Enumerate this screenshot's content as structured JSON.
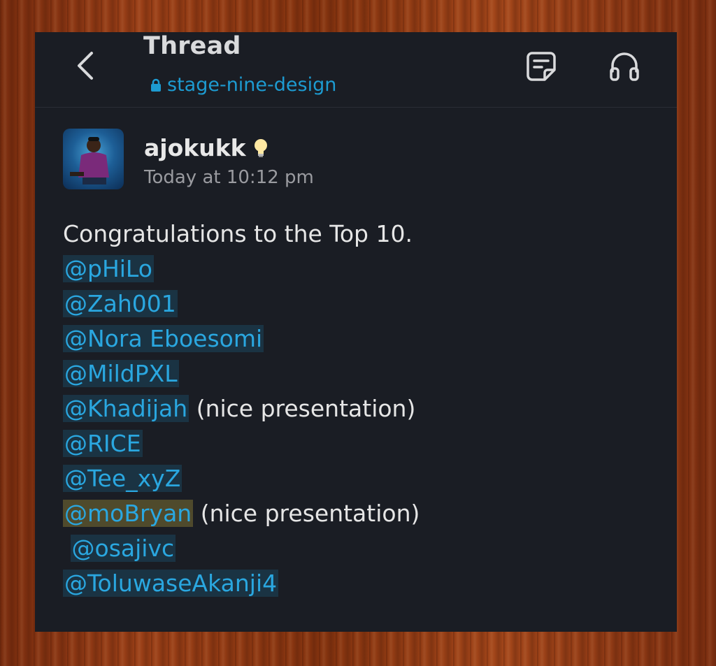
{
  "header": {
    "title": "Thread",
    "channel": "stage-nine-design",
    "back_icon": "chevron-left-icon",
    "notes_icon": "notes-icon",
    "huddle_icon": "headphones-icon"
  },
  "message": {
    "username": "ajokukk",
    "status_emoji": "light-bulb",
    "timestamp": "Today at 10:12 pm",
    "intro": "Congratulations to the Top 10.",
    "mentions": [
      {
        "handle": "@pHiLo",
        "note": ""
      },
      {
        "handle": "@Zah001",
        "note": ""
      },
      {
        "handle": "@Nora Eboesomi",
        "note": ""
      },
      {
        "handle": "@MildPXL",
        "note": ""
      },
      {
        "handle": "@Khadijah",
        "note": " (nice presentation)"
      },
      {
        "handle": "@RICE",
        "note": ""
      },
      {
        "handle": "@Tee_xyZ",
        "note": ""
      },
      {
        "handle": "@moBryan",
        "note": " (nice presentation)"
      },
      {
        "handle": "@osajivc",
        "note": ""
      },
      {
        "handle": "@ToluwaseAkanji4",
        "note": ""
      }
    ]
  },
  "colors": {
    "background": "#1a1d24",
    "link": "#1d9bd1",
    "mention_bg": "rgba(29,155,209,0.18)",
    "highlight_mention_bg": "rgba(180,160,60,0.35)",
    "frame": "#8a3612"
  }
}
